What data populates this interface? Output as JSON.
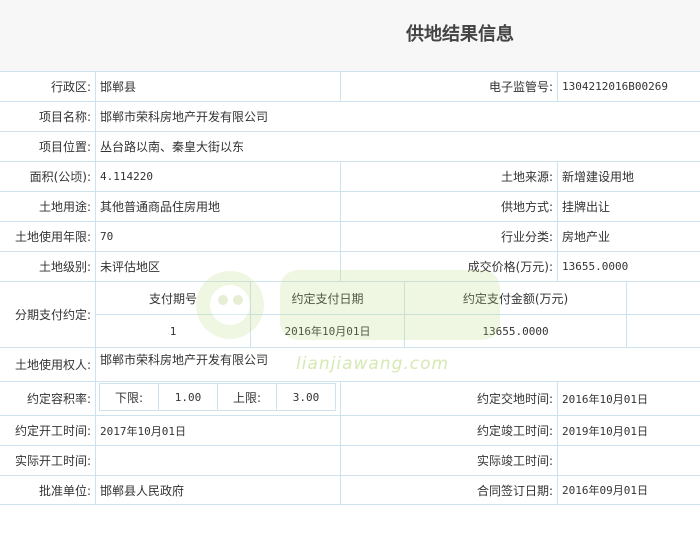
{
  "header": {
    "title": "供地结果信息"
  },
  "rows": {
    "district": {
      "label": "行政区:",
      "value": "邯郸县"
    },
    "supervision_no": {
      "label": "电子监管号:",
      "value": "1304212016B00269"
    },
    "project_name": {
      "label": "项目名称:",
      "value": "邯郸市荣科房地产开发有限公司"
    },
    "project_location": {
      "label": "项目位置:",
      "value": "丛台路以南、秦皇大街以东"
    },
    "area": {
      "label": "面积(公顷):",
      "value": "4.114220"
    },
    "land_source": {
      "label": "土地来源:",
      "value": "新增建设用地"
    },
    "land_use": {
      "label": "土地用途:",
      "value": "其他普通商品住房用地"
    },
    "supply_method": {
      "label": "供地方式:",
      "value": "挂牌出让"
    },
    "use_term": {
      "label": "土地使用年限:",
      "value": "70"
    },
    "industry": {
      "label": "行业分类:",
      "value": "房地产业"
    },
    "land_grade": {
      "label": "土地级别:",
      "value": "未评估地区"
    },
    "deal_price": {
      "label": "成交价格(万元):",
      "value": "13655.0000"
    },
    "installments": {
      "label": "分期支付约定:",
      "headers": [
        "支付期号",
        "约定支付日期",
        "约定支付金额(万元)"
      ],
      "rows": [
        {
          "period": "1",
          "date": "2016年10月01日",
          "amount": "13655.0000"
        }
      ]
    },
    "land_user": {
      "label": "土地使用权人:",
      "value": "邯郸市荣科房地产开发有限公司"
    },
    "plot_ratio": {
      "label": "约定容积率:",
      "lower_label": "下限:",
      "lower": "1.00",
      "upper_label": "上限:",
      "upper": "3.00"
    },
    "handover_time": {
      "label": "约定交地时间:",
      "value": "2016年10月01日"
    },
    "start_time": {
      "label": "约定开工时间:",
      "value": "2017年10月01日"
    },
    "complete_time": {
      "label": "约定竣工时间:",
      "value": "2019年10月01日"
    },
    "actual_start": {
      "label": "实际开工时间:",
      "value": ""
    },
    "actual_complete": {
      "label": "实际竣工时间:",
      "value": ""
    },
    "approver": {
      "label": "批准单位:",
      "value": "邯郸县人民政府"
    },
    "contract_date": {
      "label": "合同签订日期:",
      "value": "2016年09月01日"
    }
  },
  "watermark": {
    "text": "lianjiawang.com"
  }
}
